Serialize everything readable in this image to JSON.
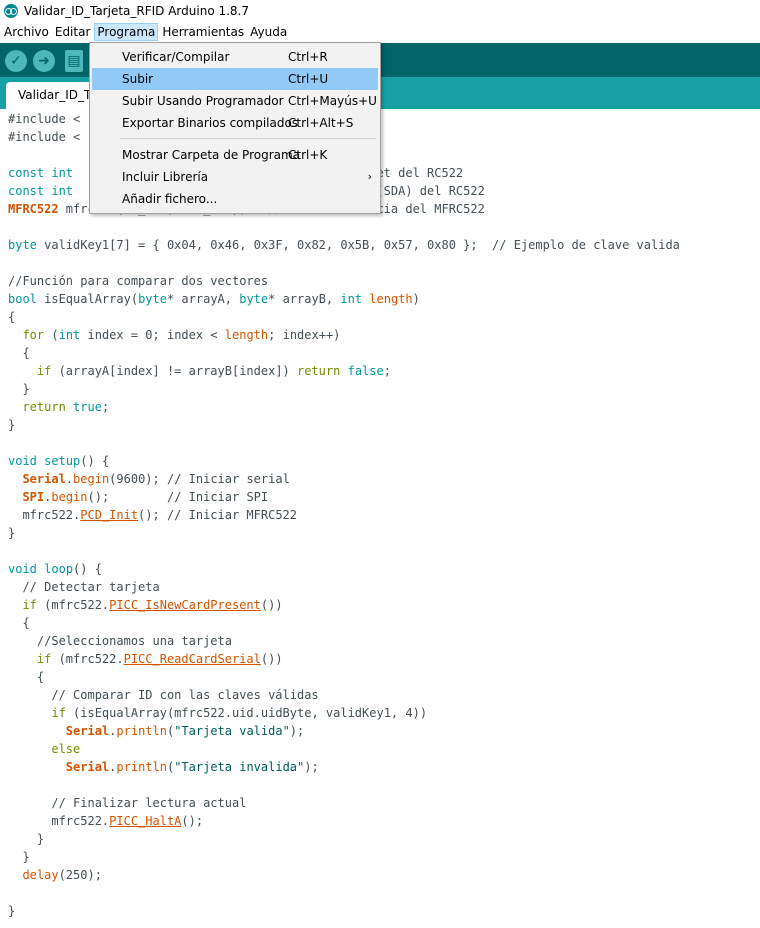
{
  "window": {
    "title": "Validar_ID_Tarjeta_RFID Arduino 1.8.7"
  },
  "menubar": {
    "items": [
      "Archivo",
      "Editar",
      "Programa",
      "Herramientas",
      "Ayuda"
    ],
    "active": "Programa"
  },
  "toolbar": {
    "verify_icon": "check-icon",
    "upload_icon": "arrow-right-icon",
    "new_icon": "file-icon"
  },
  "tabs": [
    {
      "label": "Validar_ID_Tarjeta_RFID"
    }
  ],
  "menu": {
    "items": [
      {
        "label": "Verificar/Compilar",
        "shortcut": "Ctrl+R"
      },
      {
        "label": "Subir",
        "shortcut": "Ctrl+U",
        "highlighted": true
      },
      {
        "label": "Subir Usando Programador",
        "shortcut": "Ctrl+Mayús+U"
      },
      {
        "label": "Exportar Binarios compilados",
        "shortcut": "Ctrl+Alt+S"
      },
      {
        "label": "Mostrar Carpeta de Programa",
        "shortcut": "Ctrl+K"
      },
      {
        "label": "Incluir Librería",
        "shortcut": "",
        "submenu": true
      },
      {
        "label": "Añadir fichero...",
        "shortcut": ""
      }
    ]
  },
  "code": [
    [
      [
        "p",
        "#include <"
      ]
    ],
    [
      [
        "p",
        "#include <"
      ]
    ],
    [],
    [
      [
        "k",
        "const int "
      ],
      [
        "p",
        "                                      reset del RC522"
      ]
    ],
    [
      [
        "k",
        "const int "
      ],
      [
        "p",
        "                                      SS (SDA) del RC522"
      ]
    ],
    [
      [
        "c",
        "MFRC522"
      ],
      [
        "p",
        " mfrc522(SS_PIN, RST_PIN);   // Crear instancia del MFRC522"
      ]
    ],
    [],
    [
      [
        "k",
        "byte"
      ],
      [
        "p",
        " validKey1[7] = { 0x04, 0x46, 0x3F, 0x82, 0x5B, 0x57, 0x80 };  // Ejemplo de clave valida"
      ]
    ],
    [],
    [
      [
        "p",
        "//Función para comparar dos vectores"
      ]
    ],
    [
      [
        "k",
        "bool"
      ],
      [
        "p",
        " isEqualArray("
      ],
      [
        "k",
        "byte"
      ],
      [
        "p",
        "* arrayA, "
      ],
      [
        "k",
        "byte"
      ],
      [
        "p",
        "* arrayB, "
      ],
      [
        "k",
        "int"
      ],
      [
        "p",
        " "
      ],
      [
        "f",
        "length"
      ],
      [
        "p",
        ")"
      ]
    ],
    [
      [
        "p",
        "{"
      ]
    ],
    [
      [
        "p",
        "  "
      ],
      [
        "g",
        "for"
      ],
      [
        "p",
        " ("
      ],
      [
        "k",
        "int"
      ],
      [
        "p",
        " index = 0; index < "
      ],
      [
        "f",
        "length"
      ],
      [
        "p",
        "; index++)"
      ]
    ],
    [
      [
        "p",
        "  {"
      ]
    ],
    [
      [
        "p",
        "    "
      ],
      [
        "g",
        "if"
      ],
      [
        "p",
        " (arrayA[index] != arrayB[index]) "
      ],
      [
        "g",
        "return"
      ],
      [
        "p",
        " "
      ],
      [
        "k",
        "false"
      ],
      [
        "p",
        ";"
      ]
    ],
    [
      [
        "p",
        "  }"
      ]
    ],
    [
      [
        "p",
        "  "
      ],
      [
        "g",
        "return"
      ],
      [
        "p",
        " "
      ],
      [
        "k",
        "true"
      ],
      [
        "p",
        ";"
      ]
    ],
    [
      [
        "p",
        "}"
      ]
    ],
    [],
    [
      [
        "k",
        "void"
      ],
      [
        "p",
        " "
      ],
      [
        "k",
        "setup"
      ],
      [
        "p",
        "() {"
      ]
    ],
    [
      [
        "p",
        "  "
      ],
      [
        "c",
        "Serial"
      ],
      [
        "p",
        "."
      ],
      [
        "f",
        "begin"
      ],
      [
        "p",
        "(9600); // Iniciar serial"
      ]
    ],
    [
      [
        "p",
        "  "
      ],
      [
        "c",
        "SPI"
      ],
      [
        "p",
        "."
      ],
      [
        "f",
        "begin"
      ],
      [
        "p",
        "();        // Iniciar SPI"
      ]
    ],
    [
      [
        "p",
        "  mfrc522."
      ],
      [
        "u",
        "PCD_Init"
      ],
      [
        "p",
        "(); // Iniciar MFRC522"
      ]
    ],
    [
      [
        "p",
        "}"
      ]
    ],
    [],
    [
      [
        "k",
        "void"
      ],
      [
        "p",
        " "
      ],
      [
        "k",
        "loop"
      ],
      [
        "p",
        "() {"
      ]
    ],
    [
      [
        "p",
        "  // Detectar tarjeta"
      ]
    ],
    [
      [
        "p",
        "  "
      ],
      [
        "g",
        "if"
      ],
      [
        "p",
        " (mfrc522."
      ],
      [
        "u",
        "PICC_IsNewCardPresent"
      ],
      [
        "p",
        "())"
      ]
    ],
    [
      [
        "p",
        "  {"
      ]
    ],
    [
      [
        "p",
        "    //Seleccionamos una tarjeta"
      ]
    ],
    [
      [
        "p",
        "    "
      ],
      [
        "g",
        "if"
      ],
      [
        "p",
        " (mfrc522."
      ],
      [
        "u",
        "PICC_ReadCardSerial"
      ],
      [
        "p",
        "())"
      ]
    ],
    [
      [
        "p",
        "    {"
      ]
    ],
    [
      [
        "p",
        "      // Comparar ID con las claves válidas"
      ]
    ],
    [
      [
        "p",
        "      "
      ],
      [
        "g",
        "if"
      ],
      [
        "p",
        " (isEqualArray(mfrc522.uid.uidByte, validKey1, 4))"
      ]
    ],
    [
      [
        "p",
        "        "
      ],
      [
        "c",
        "Serial"
      ],
      [
        "p",
        "."
      ],
      [
        "f",
        "println"
      ],
      [
        "p",
        "("
      ],
      [
        "s",
        "\"Tarjeta valida\""
      ],
      [
        "p",
        ");"
      ]
    ],
    [
      [
        "p",
        "      "
      ],
      [
        "g",
        "else"
      ]
    ],
    [
      [
        "p",
        "        "
      ],
      [
        "c",
        "Serial"
      ],
      [
        "p",
        "."
      ],
      [
        "f",
        "println"
      ],
      [
        "p",
        "("
      ],
      [
        "s",
        "\"Tarjeta invalida\""
      ],
      [
        "p",
        ");"
      ]
    ],
    [],
    [
      [
        "p",
        "      // Finalizar lectura actual"
      ]
    ],
    [
      [
        "p",
        "      mfrc522."
      ],
      [
        "u",
        "PICC_HaltA"
      ],
      [
        "p",
        "();"
      ]
    ],
    [
      [
        "p",
        "    }"
      ]
    ],
    [
      [
        "p",
        "  }"
      ]
    ],
    [
      [
        "p",
        "  "
      ],
      [
        "f",
        "delay"
      ],
      [
        "p",
        "(250);"
      ]
    ],
    [],
    [
      [
        "p",
        "}"
      ]
    ]
  ]
}
